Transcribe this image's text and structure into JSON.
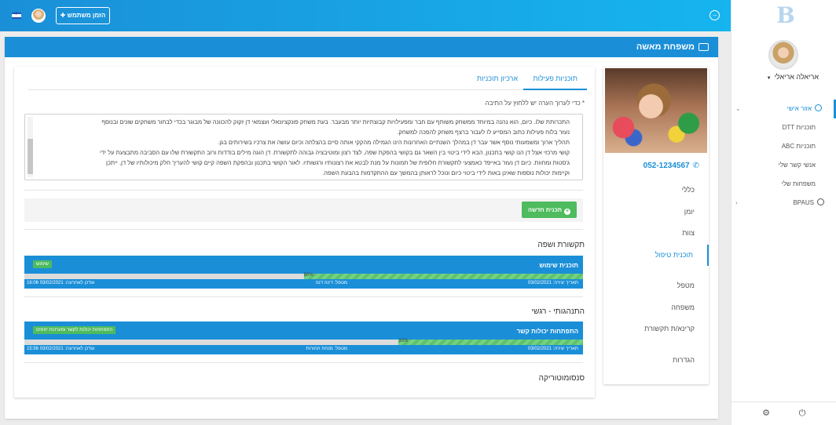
{
  "topbar": {
    "invite_label": "הזמן משתמש",
    "exit_icon": "exit-icon",
    "flag": "israel-flag"
  },
  "sidebar": {
    "user_name": "אריאלה אריאלי",
    "menu": [
      {
        "label": "אזור אישי",
        "active": true,
        "icon": "user-circle-icon"
      },
      {
        "label": "תוכניות DTT",
        "sub": true
      },
      {
        "label": "תוכניות ABC",
        "sub": true
      },
      {
        "label": "אנשי קשר שלי",
        "sub": true
      },
      {
        "label": "משפחות שלי",
        "sub": true
      },
      {
        "label": "BPAUS",
        "icon": "target-icon"
      }
    ]
  },
  "panel": {
    "title": "משפחת מאשה"
  },
  "profile": {
    "phone": "052-1234567",
    "menu": [
      {
        "label": "כללי"
      },
      {
        "label": "יומן"
      },
      {
        "label": "צוות"
      },
      {
        "label": "תוכנית טיפול",
        "active": true
      },
      {
        "label": "מטפל"
      },
      {
        "label": "משפחה"
      },
      {
        "label": "קרינא/ת תקשורת"
      },
      {
        "label": "הגדרות"
      }
    ]
  },
  "main": {
    "tabs": [
      {
        "label": "תוכניות פעילות",
        "active": true
      },
      {
        "label": "ארכיון תוכניות"
      }
    ],
    "hint": "* כדי לערוך הערה יש ללחוץ על התיבה",
    "note_lines": [
      "התכרותת שלו. כיום, הוא נהנה במיוחד ממשחק משותף עם חבר ומפעילויות קבוצתיות יותר מבעבר. בעת משחק פונקציונאלי ועצמאי דן זקוק להכוונה של מבוגר בכדי לבחור משחקים שונים ובנוסף",
      "נעזר בלוח פעילות כתוב המסייע לו לעבור ברצף משחק להפכה למשחק.",
      "תהליך ארוך ומשמעותי נוסף אשר עבר דן במהלך השנתיים האחרונות הינו הגמילה מהקקי אותה סיים בהצלחה וכיום עושה את צרכיו בשירותים בגן.",
      "קושי מרכזי אצל דן הנו קושי בתכנון, הבא לידי ביטוי בין השאר גם בקושי בהפקת שפה, לצד רצון ומוטיבציה גבוהה לתקשורת. דן הוגה מילים בודדות ורוב התקשורת שלו עם הסביבה מתבצעת על ידי",
      "ג'סטות ומחוות. כיום דן נעזר באייפד כאמצעי לתקשורת חלופית של תמונות על מנת לבטא את רצונותיו ורגשותיו. לאור הקושי בתכנון ובהפקת השפה קיים קושי להעריך חלק מיכולותיו של דן, ייתכן",
      "וקיימות יכולות נוספות שאינן באות לידי ביטוי כיום ונוכל לראותן בהמשך עם ההתקדמות בהבעת השפה."
    ],
    "new_plan_label": "תכנית חדשה",
    "sections": [
      {
        "title": "תקשורת ושפה",
        "plan_title": "תוכנית שימוש",
        "tag": "שימוש",
        "progress": 50,
        "progress_text": "50%",
        "created": "תאריך יצירה: 03/02/2021",
        "therapist": "מטפל: דינה דנה",
        "updated": "עודכן לאחרונה: 03/02/2021 16:06"
      },
      {
        "title": "התנהגותי - רגשי",
        "plan_title": "התפתחות יכולות קשר",
        "tag": "התפתחות יכולות לקשר ומערכות יחסים",
        "progress": 33,
        "progress_text": "33%",
        "created": "תאריך יצירה: 03/02/2021",
        "therapist": "מטפל: מנחת ההורות",
        "updated": "עודכן לאחרונה: 03/02/2021 15:56"
      },
      {
        "title": "סנסומוטוריקה"
      }
    ]
  }
}
